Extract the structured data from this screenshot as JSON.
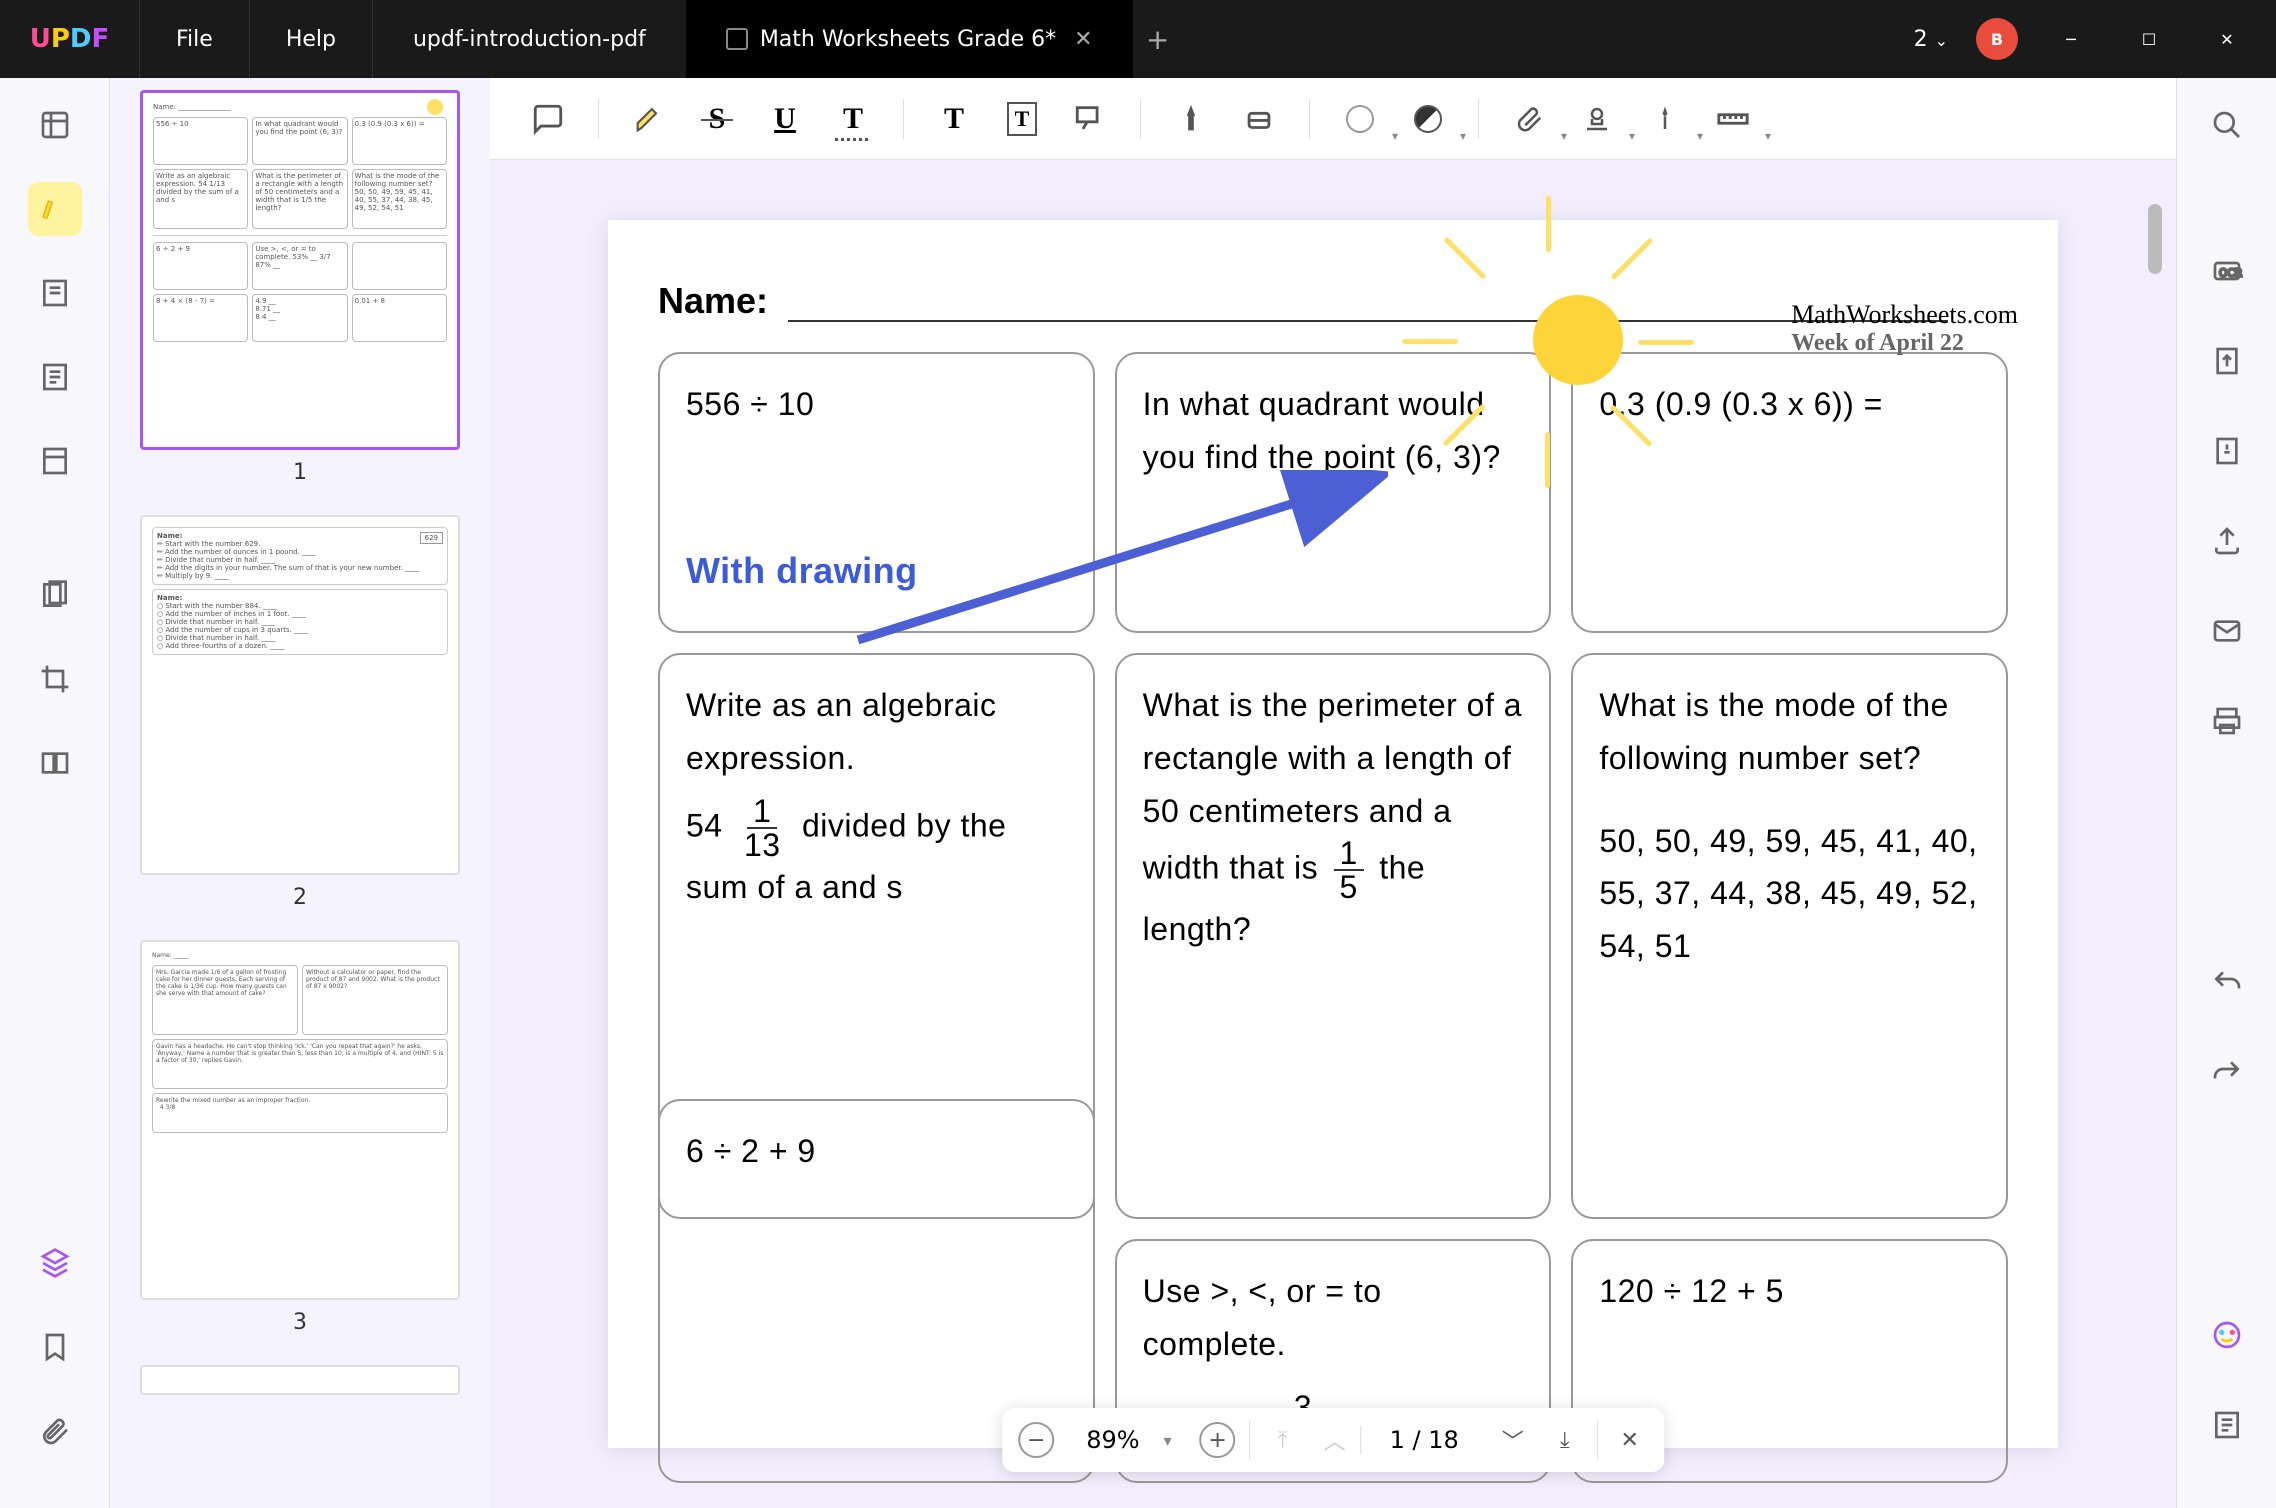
{
  "titlebar": {
    "file": "File",
    "help": "Help",
    "tabs": [
      {
        "label": "updf-introduction-pdf",
        "active": false
      },
      {
        "label": "Math Worksheets Grade 6*",
        "active": true
      }
    ],
    "notif_count": "2",
    "avatar_letter": "B"
  },
  "document": {
    "brand": "MathWorksheets.com",
    "week": "Week of April 22",
    "name_label": "Name:",
    "annotation_label": "With drawing",
    "questions": {
      "r1c1": "556 ÷ 10",
      "r1c2": "In what quadrant would you find the point (6, 3)?",
      "r1c3": "0.3 (0.9 (0.3 x 6)) =",
      "r2c1_a": "Write as an algebraic expression.",
      "r2c1_b_pre": "54",
      "r2c1_b_num": "1",
      "r2c1_b_den": "13",
      "r2c1_b_post": " divided by the sum of a and s",
      "r2c2_a": "What is the perimeter of a rectangle with a length of 50 centimeters and a width that is ",
      "r2c2_num": "1",
      "r2c2_den": "5",
      "r2c2_b": " the length?",
      "r2c3_a": "What is the mode of the following number set?",
      "r2c3_b": "50, 50, 49, 59, 45, 41, 40, 55, 37, 44, 38, 45, 49, 52, 54, 51",
      "r3c1": "6 ÷ 2 + 9",
      "r3c2_a": "Use >, <, or = to complete.",
      "r3c2_b_pre": "53%  ___  ",
      "r3c2_b_num": "3",
      "r3c2_b_den": "7",
      "r3c3": "120 ÷ 12 + 5"
    }
  },
  "thumbs": {
    "t1": "1",
    "t2": "2",
    "t3": "3"
  },
  "status": {
    "zoom": "89%",
    "page_cur": "1",
    "page_sep": " / ",
    "page_total": "18"
  }
}
